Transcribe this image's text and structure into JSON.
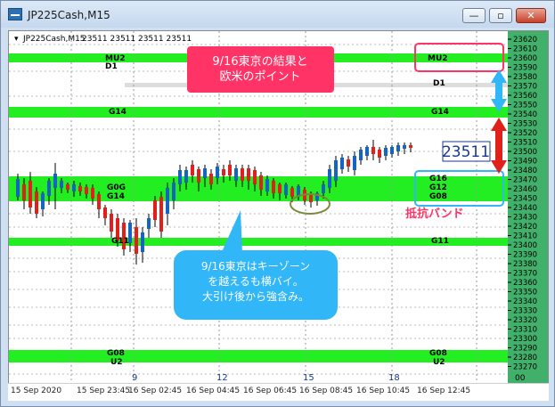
{
  "window": {
    "title": "JP225Cash,M15",
    "min_glyph": "—",
    "max_glyph": "▫",
    "close_glyph": "✕"
  },
  "chart_header": {
    "symbol": "JP225Cash,M15",
    "quotes": "23511 23511 23511 23511"
  },
  "colors": {
    "band": "#22ee22",
    "band_dark": "#1fb25a",
    "up_candle": "#1565c0",
    "down_candle": "#e0201a",
    "price_axis": "#41b06a",
    "red_callout": "#ff3366",
    "blue_callout": "#31b6f7",
    "circle": "#7a8a3a"
  },
  "price_axis_ticks": [
    "23620",
    "23610",
    "23600",
    "23590",
    "23580",
    "23570",
    "23560",
    "23550",
    "23540",
    "23530",
    "23520",
    "23510",
    "23500",
    "23490",
    "23480",
    "23470",
    "23460",
    "23450",
    "23440",
    "23430",
    "23420",
    "23410",
    "23400",
    "23390",
    "23380",
    "23370",
    "23360",
    "23350",
    "23340",
    "23330",
    "23320",
    "23310",
    "23300",
    "23290",
    "23280",
    "23270"
  ],
  "price_axis_end_label": "00",
  "band_labels": {
    "mu2": "MU2",
    "d1": "D1",
    "g14": "G14",
    "g16": "G16",
    "g12": "G12",
    "g11": "G11",
    "g08": "G08",
    "u2": "U2",
    "c13_left": "G0G",
    "c14_left": "G14",
    "g13_left": "G08"
  },
  "grid_day_labels": [
    "9",
    "12",
    "15",
    "18"
  ],
  "time_axis": [
    "15 Sep 2020",
    "15 Sep 23:45",
    "16 Sep 02:45",
    "16 Sep 04:45",
    "16 Sep 06:45",
    "16 Sep 08:45",
    "16 Sep 10:45",
    "16 Sep 12:45"
  ],
  "current_price_label": "23511",
  "annotations": {
    "top_box": "9/16東京の結果と\n欧米のポイント",
    "resistance_band": "抵抗バンド",
    "speech_bubble": "9/16東京はキーゾーン\nを越えるも横バイ。\n大引け後から強含み。"
  }
}
